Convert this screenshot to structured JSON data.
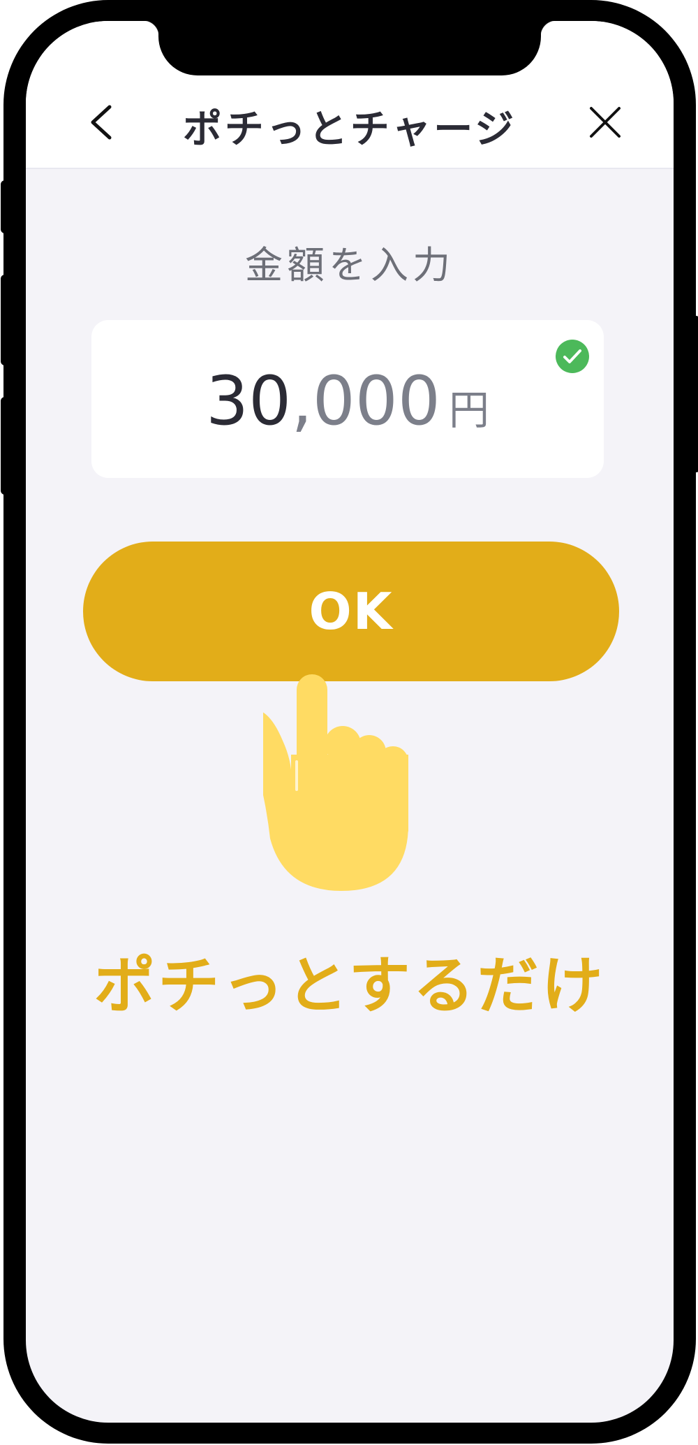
{
  "header": {
    "title": "ポチっとチャージ",
    "back_icon": "chevron-left-icon",
    "close_icon": "close-icon"
  },
  "amount": {
    "label": "金額を入力",
    "value_dark": "30",
    "value_grey": ",000",
    "unit": "円",
    "status_icon": "check-circle-icon"
  },
  "ok_button": {
    "label": "OK"
  },
  "tagline": "ポチっとするだけ",
  "colors": {
    "accent": "#e2ad19",
    "hand": "#ffdb63",
    "success": "#4cb95a",
    "screen_bg": "#f4f3f8",
    "title_text": "#2b2b35",
    "muted_text": "#7c7f8a"
  }
}
